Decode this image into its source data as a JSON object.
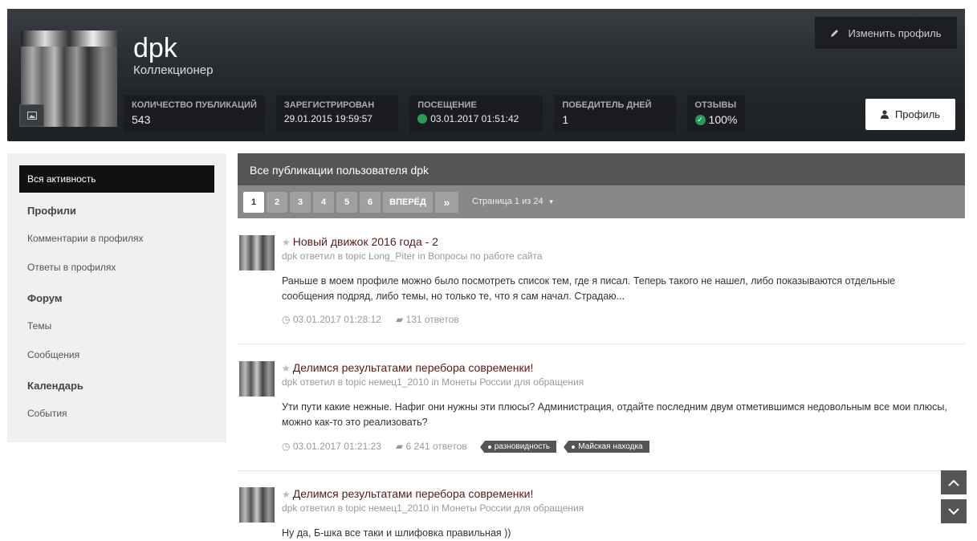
{
  "profile": {
    "username": "dpk",
    "rank": "Коллекционер",
    "edit_label": "Изменить профиль",
    "profile_label": "Профиль",
    "stats": [
      {
        "label": "Количество публикаций",
        "value": "543"
      },
      {
        "label": "Зарегистрирован",
        "value": "29.01.2015 19:59:57"
      },
      {
        "label": "Посещение",
        "value": "03.01.2017 01:51:42"
      },
      {
        "label": "Победитель дней",
        "value": "1"
      },
      {
        "label": "Отзывы",
        "value": "100%"
      }
    ],
    "status_color": "#2b9a57"
  },
  "sidebar": {
    "active": "Вся активность",
    "sections": [
      {
        "title": "Профили",
        "items": [
          "Комментарии в профилях",
          "Ответы в профилях"
        ]
      },
      {
        "title": "Форум",
        "items": [
          "Темы",
          "Сообщения"
        ]
      },
      {
        "title": "Календарь",
        "items": [
          "События"
        ]
      }
    ]
  },
  "main": {
    "heading": "Все публикации пользователя dpk",
    "pager": {
      "pages": [
        "1",
        "2",
        "3",
        "4",
        "5",
        "6"
      ],
      "next": "ВПЕРЁД",
      "last": "»",
      "info": "Страница 1 из 24"
    },
    "posts": [
      {
        "title": "Новый движок 2016 года - 2",
        "meta": "dpk ответил в topic Long_Piter in Вопросы по работе сайта",
        "body": "Раньше в моем профиле можно было посмотреть список тем, где я писал. Теперь такого не нашел, либо показываются отдельные сообщения подряд, либо темы, но только те, что я сам начал. Страдаю...",
        "date": "03.01.2017 01:28:12",
        "replies": "131 ответов",
        "tags": []
      },
      {
        "title": "Делимся результатами перебора современки!",
        "meta": "dpk ответил в topic немец1_2010 in Монеты России для обращения",
        "body": "Ути пути какие нежные. Нафиг они нужны эти плюсы? Администрация, отдайте последним двум отметившимся недовольным все мои плюсы, можно как-то это реализовать?",
        "date": "03.01.2017 01:21:23",
        "replies": "6 241 ответов",
        "tags": [
          "разновидность",
          "Майская находка"
        ]
      },
      {
        "title": "Делимся результатами перебора современки!",
        "meta": "dpk ответил в topic немец1_2010 in Монеты России для обращения",
        "body": "Ну да, Б-шка все таки и шлифовка правильная ))",
        "date": "",
        "replies": "",
        "tags": []
      }
    ]
  },
  "icons": {
    "pencil": "pencil-icon",
    "user": "user-icon",
    "image": "image-icon",
    "clock": "clock-icon",
    "comment": "comment-icon",
    "star": "star-icon",
    "caret": "caret-down-icon",
    "up": "chevron-up-icon",
    "down": "chevron-down-icon"
  }
}
